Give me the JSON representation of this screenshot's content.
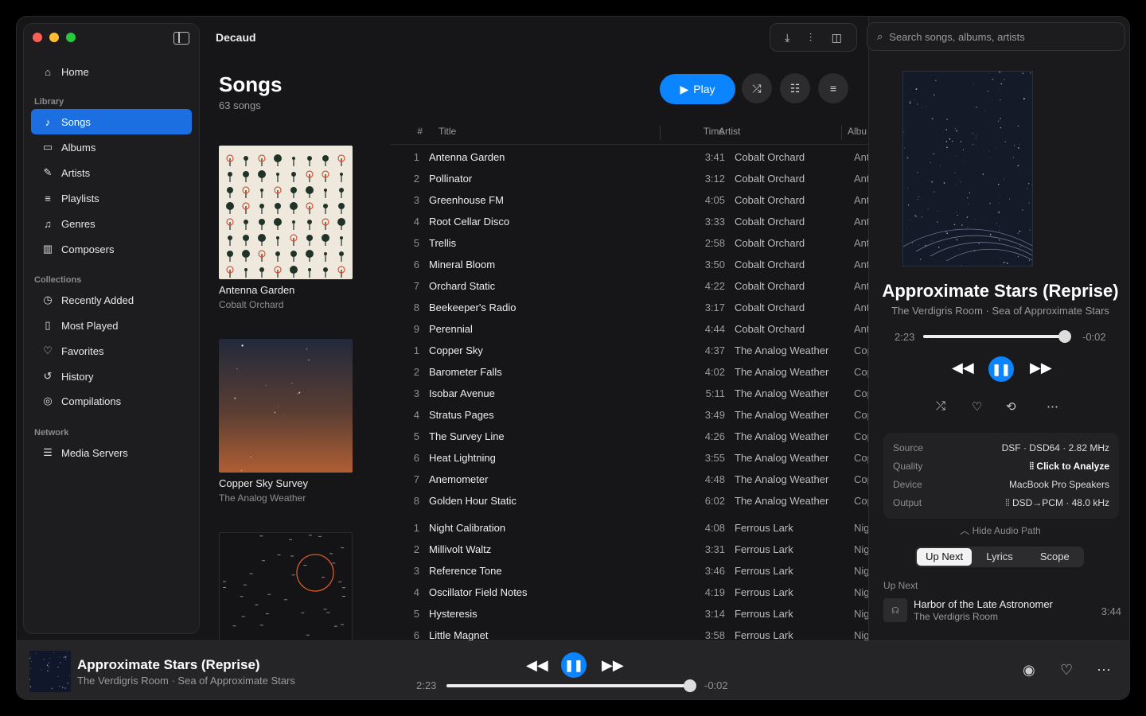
{
  "app": {
    "title": "Decaud"
  },
  "sidebar": {
    "home": "Home",
    "library_label": "Library",
    "library": [
      {
        "label": "Songs",
        "icon": "music-note-icon"
      },
      {
        "label": "Albums",
        "icon": "album-icon"
      },
      {
        "label": "Artists",
        "icon": "mic-icon"
      },
      {
        "label": "Playlists",
        "icon": "playlist-icon"
      },
      {
        "label": "Genres",
        "icon": "genres-icon"
      },
      {
        "label": "Composers",
        "icon": "piano-icon"
      }
    ],
    "collections_label": "Collections",
    "collections": [
      {
        "label": "Recently Added",
        "icon": "clock-icon"
      },
      {
        "label": "Most Played",
        "icon": "bars-icon"
      },
      {
        "label": "Favorites",
        "icon": "heart-icon"
      },
      {
        "label": "History",
        "icon": "history-icon"
      },
      {
        "label": "Compilations",
        "icon": "compilation-icon"
      }
    ],
    "network_label": "Network",
    "network": [
      {
        "label": "Media Servers",
        "icon": "server-icon"
      }
    ]
  },
  "main": {
    "heading": "Songs",
    "count": "63 songs",
    "play_label": "Play",
    "columns": {
      "num": "#",
      "title": "Title",
      "time": "Time",
      "artist": "Artist",
      "album": "Albu"
    },
    "albums": [
      {
        "title": "Antenna Garden",
        "artist": "Cobalt Orchard"
      },
      {
        "title": "Copper Sky Survey",
        "artist": "The Analog Weather"
      },
      {
        "title": "",
        "artist": ""
      }
    ],
    "tracks": [
      {
        "n": "1",
        "title": "Antenna Garden",
        "time": "3:41",
        "artist": "Cobalt Orchard",
        "album": "Ant"
      },
      {
        "n": "2",
        "title": "Pollinator",
        "time": "3:12",
        "artist": "Cobalt Orchard",
        "album": "Ant"
      },
      {
        "n": "3",
        "title": "Greenhouse FM",
        "time": "4:05",
        "artist": "Cobalt Orchard",
        "album": "Ant"
      },
      {
        "n": "4",
        "title": "Root Cellar Disco",
        "time": "3:33",
        "artist": "Cobalt Orchard",
        "album": "Ant"
      },
      {
        "n": "5",
        "title": "Trellis",
        "time": "2:58",
        "artist": "Cobalt Orchard",
        "album": "Ant"
      },
      {
        "n": "6",
        "title": "Mineral Bloom",
        "time": "3:50",
        "artist": "Cobalt Orchard",
        "album": "Ant"
      },
      {
        "n": "7",
        "title": "Orchard Static",
        "time": "4:22",
        "artist": "Cobalt Orchard",
        "album": "Ant"
      },
      {
        "n": "8",
        "title": "Beekeeper's Radio",
        "time": "3:17",
        "artist": "Cobalt Orchard",
        "album": "Ant"
      },
      {
        "n": "9",
        "title": "Perennial",
        "time": "4:44",
        "artist": "Cobalt Orchard",
        "album": "Ant"
      },
      {
        "n": "1",
        "title": "Copper Sky",
        "time": "4:37",
        "artist": "The Analog Weather",
        "album": "Cop"
      },
      {
        "n": "2",
        "title": "Barometer Falls",
        "time": "4:02",
        "artist": "The Analog Weather",
        "album": "Cop"
      },
      {
        "n": "3",
        "title": "Isobar Avenue",
        "time": "5:11",
        "artist": "The Analog Weather",
        "album": "Cop"
      },
      {
        "n": "4",
        "title": "Stratus Pages",
        "time": "3:49",
        "artist": "The Analog Weather",
        "album": "Cop"
      },
      {
        "n": "5",
        "title": "The Survey Line",
        "time": "4:26",
        "artist": "The Analog Weather",
        "album": "Cop"
      },
      {
        "n": "6",
        "title": "Heat Lightning",
        "time": "3:55",
        "artist": "The Analog Weather",
        "album": "Cop"
      },
      {
        "n": "7",
        "title": "Anemometer",
        "time": "4:48",
        "artist": "The Analog Weather",
        "album": "Cop"
      },
      {
        "n": "8",
        "title": "Golden Hour Static",
        "time": "6:02",
        "artist": "The Analog Weather",
        "album": "Cop"
      },
      {
        "n": "1",
        "title": "Night Calibration",
        "time": "4:08",
        "artist": "Ferrous Lark",
        "album": "Nig"
      },
      {
        "n": "2",
        "title": "Millivolt Waltz",
        "time": "3:31",
        "artist": "Ferrous Lark",
        "album": "Nig"
      },
      {
        "n": "3",
        "title": "Reference Tone",
        "time": "3:46",
        "artist": "Ferrous Lark",
        "album": "Nig"
      },
      {
        "n": "4",
        "title": "Oscillator Field Notes",
        "time": "4:19",
        "artist": "Ferrous Lark",
        "album": "Nig"
      },
      {
        "n": "5",
        "title": "Hysteresis",
        "time": "3:14",
        "artist": "Ferrous Lark",
        "album": "Nig"
      },
      {
        "n": "6",
        "title": "Little Magnet",
        "time": "3:58",
        "artist": "Ferrous Lark",
        "album": "Nig"
      }
    ]
  },
  "right": {
    "search_placeholder": "Search songs, albums, artists",
    "now_playing": {
      "title": "Approximate Stars (Reprise)",
      "subtitle": "The Verdigris Room · Sea of Approximate Stars",
      "elapsed": "2:23",
      "remaining": "-0:02",
      "progress": 0.98
    },
    "info": [
      {
        "k": "Source",
        "v": "DSF · DSD64 · 2.82 MHz",
        "bold": false
      },
      {
        "k": "Quality",
        "v": "Click to Analyze",
        "bold": true
      },
      {
        "k": "Device",
        "v": "MacBook Pro Speakers",
        "bold": false
      },
      {
        "k": "Output",
        "v": "DSD→PCM · 48.0 kHz",
        "bold": false
      }
    ],
    "hide_path": "Hide Audio Path",
    "tabs": [
      "Up Next",
      "Lyrics",
      "Scope"
    ],
    "active_tab": "Up Next",
    "up_next_label": "Up Next",
    "up_next": {
      "title": "Harbor of the Late Astronomer",
      "artist": "The Verdigris Room",
      "time": "3:44"
    }
  },
  "player": {
    "title": "Approximate Stars (Reprise)",
    "subtitle": "The Verdigris Room · Sea of Approximate Stars",
    "elapsed": "2:23",
    "remaining": "-0:02",
    "progress": 0.98
  },
  "colors": {
    "accent": "#0a84ff",
    "sidebar_active": "#1b6fe0"
  }
}
